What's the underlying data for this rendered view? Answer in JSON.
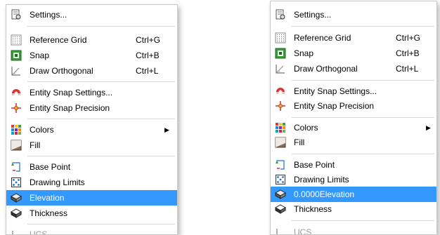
{
  "menu_left": {
    "settings": "Settings...",
    "reference_grid": {
      "label": "Reference Grid",
      "shortcut": "Ctrl+G"
    },
    "snap": {
      "label": "Snap",
      "shortcut": "Ctrl+B"
    },
    "draw_orthogonal": {
      "label": "Draw Orthogonal",
      "shortcut": "Ctrl+L"
    },
    "entity_snap_settings": "Entity Snap Settings...",
    "entity_snap_precision": "Entity Snap Precision",
    "colors": "Colors",
    "fill": "Fill",
    "base_point": "Base Point",
    "drawing_limits": "Drawing Limits",
    "elevation": "Elevation",
    "thickness": "Thickness",
    "ucs_partial": "UCS"
  },
  "menu_right": {
    "settings": "Settings...",
    "reference_grid": {
      "label": "Reference Grid",
      "shortcut": "Ctrl+G"
    },
    "snap": {
      "label": "Snap",
      "shortcut": "Ctrl+B"
    },
    "draw_orthogonal": {
      "label": "Draw Orthogonal",
      "shortcut": "Ctrl+L"
    },
    "entity_snap_settings": "Entity Snap Settings...",
    "entity_snap_precision": "Entity Snap Precision",
    "colors": "Colors",
    "fill": "Fill",
    "base_point": "Base Point",
    "drawing_limits": "Drawing Limits",
    "elevation": "0.0000Elevation",
    "thickness": "Thickness",
    "ucs_partial": "UCS"
  },
  "submenu_arrow": "▶",
  "colors": {
    "highlight": "#3399ff",
    "highlight_text": "#ffffff",
    "separator": "#d8d8d8"
  }
}
